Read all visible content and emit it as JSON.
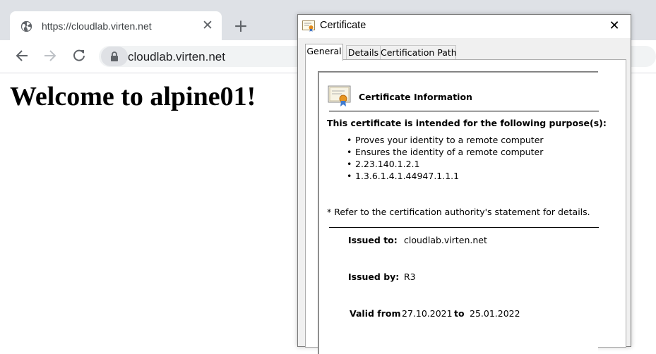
{
  "browser": {
    "tab": {
      "title": "https://cloudlab.virten.net",
      "favicon": "globe-icon",
      "close_glyph": "✕"
    },
    "new_tab_glyph": "+",
    "toolbar": {
      "back": "arrow-left-icon",
      "forward": "arrow-right-icon",
      "reload": "reload-icon",
      "lock": "lock-icon"
    },
    "omnibox": {
      "value": "cloudlab.virten.net"
    }
  },
  "page": {
    "heading": "Welcome to alpine01!"
  },
  "dialog": {
    "title": "Certificate",
    "close_glyph": "✕",
    "tabs": [
      {
        "label": "General",
        "active": true
      },
      {
        "label": "Details",
        "active": false
      },
      {
        "label": "Certification Path",
        "active": false
      }
    ],
    "info": {
      "heading": "Certificate Information",
      "purpose_title": "This certificate is intended for the following purpose(s):",
      "purposes": [
        "Proves your identity to a remote computer",
        "Ensures the identity of a remote computer",
        "2.23.140.1.2.1",
        "1.3.6.1.4.1.44947.1.1.1"
      ],
      "refer": "* Refer to the certification authority's statement for details.",
      "issued_to_label": "Issued to:",
      "issued_to_value": "cloudlab.virten.net",
      "issued_by_label": "Issued by:",
      "issued_by_value": "R3",
      "valid_from_label": "Valid from",
      "valid_from_value": "27.10.2021",
      "valid_to_label": "to",
      "valid_to_value": "25.01.2022"
    }
  },
  "colors": {
    "chrome_tabstrip": "#dee1e6",
    "omnibox": "#f1f3f4",
    "dialog_body": "#f0f0f0"
  }
}
